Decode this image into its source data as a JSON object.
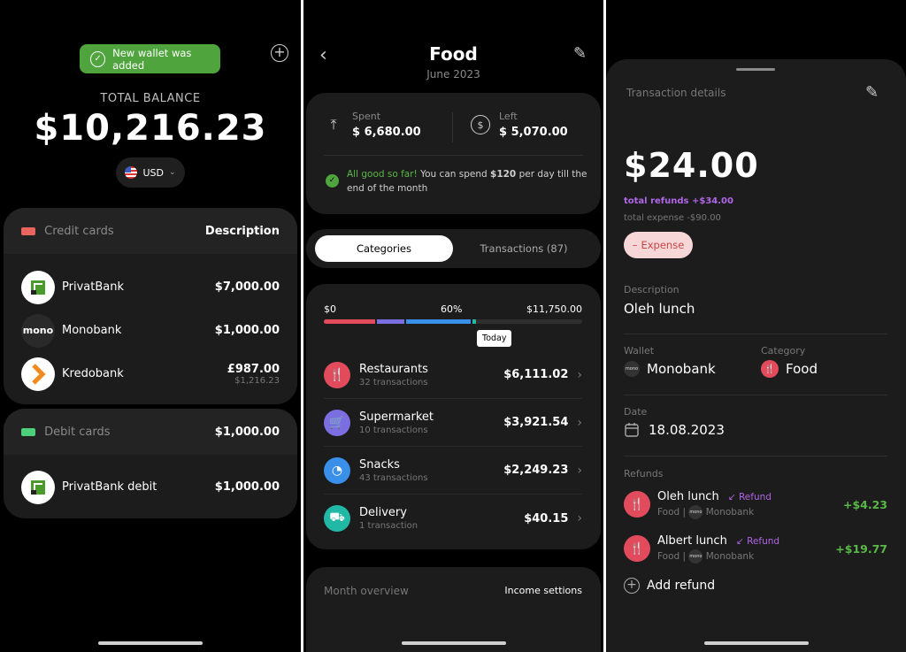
{
  "screen1": {
    "toast": "New wallet was added",
    "total_label": "TOTAL BALANCE",
    "total_value": "$10,216.23",
    "currency": "USD",
    "credit": {
      "title": "Credit cards",
      "right": "Description",
      "swatch": "#e8645f",
      "items": [
        {
          "name": "PrivatBank",
          "amount": "$7,000.00",
          "sub": ""
        },
        {
          "name": "Monobank",
          "amount": "$1,000.00",
          "sub": "",
          "logo_text": "mono"
        },
        {
          "name": "Kredobank",
          "amount": "£987.00",
          "sub": "$1,216.23"
        }
      ]
    },
    "debit": {
      "title": "Debit cards",
      "right": "$1,000.00",
      "swatch": "#4cd07a",
      "items": [
        {
          "name": "PrivatBank debit",
          "amount": "$1,000.00"
        }
      ]
    }
  },
  "screen2": {
    "title": "Food",
    "subtitle": "June 2023",
    "spent_label": "Spent",
    "spent_value": "$ 6,680.00",
    "left_label": "Left",
    "left_value": "$ 5,070.00",
    "status_good": "All good so far!",
    "status_a": "You can spend",
    "status_amount": "$120",
    "status_b": "per day till the end of the month",
    "tabs": [
      "Categories",
      "Transactions (87)"
    ],
    "progress": {
      "start": "$0",
      "mid": "60%",
      "end": "$11,750.00",
      "today": "Today",
      "fill_fraction": 0.57
    },
    "categories": [
      {
        "name": "Restaurants",
        "sub": "32 transactions",
        "amount": "$6,111.02",
        "color": "#e24b5b",
        "icon": "fork-knife-icon",
        "glyph": "🍴"
      },
      {
        "name": "Supermarket",
        "sub": "10 transactions",
        "amount": "$3,921.54",
        "color": "#7a6ee0",
        "icon": "cart-icon",
        "glyph": "🛒"
      },
      {
        "name": "Snacks",
        "sub": "43 transactions",
        "amount": "$2,249.23",
        "color": "#3a8fe8",
        "icon": "snack-icon",
        "glyph": "◔"
      },
      {
        "name": "Delivery",
        "sub": "1 transaction",
        "amount": "$40.15",
        "color": "#22b8a6",
        "icon": "truck-icon",
        "glyph": "⛟"
      }
    ],
    "month_overview": "Month overview",
    "income_settings": "Income settions"
  },
  "screen3": {
    "header": "Transaction details",
    "amount": "$24.00",
    "total_refunds": "total refunds +$34.00",
    "total_expense": "total expense -$90.00",
    "type": "Expense",
    "description_label": "Description",
    "description_value": "Oleh lunch",
    "wallet_label": "Wallet",
    "wallet_value": "Monobank",
    "category_label": "Category",
    "category_value": "Food",
    "date_label": "Date",
    "date_value": "18.08.2023",
    "refunds_label": "Refunds",
    "refunds": [
      {
        "name": "Oleh lunch",
        "tag": "Refund",
        "category": "Food",
        "wallet": "Monobank",
        "amount": "+$4.23"
      },
      {
        "name": "Albert lunch",
        "tag": "Refund",
        "category": "Food",
        "wallet": "Monobank",
        "amount": "+$19.77"
      }
    ],
    "add_refund": "Add refund"
  }
}
